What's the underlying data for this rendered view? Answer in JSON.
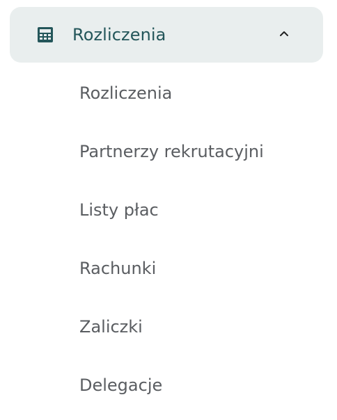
{
  "section": {
    "title": "Rozliczenia",
    "icon": "calculator-icon",
    "toggle_icon": "chevron-up-icon",
    "expanded": true,
    "colors": {
      "header_bg": "#e9eeee",
      "header_text": "#24565a",
      "item_text": "#5a5d61"
    }
  },
  "submenu": {
    "items": [
      {
        "label": "Rozliczenia"
      },
      {
        "label": "Partnerzy rekrutacyjni"
      },
      {
        "label": "Listy płac"
      },
      {
        "label": "Rachunki"
      },
      {
        "label": "Zaliczki"
      },
      {
        "label": "Delegacje"
      }
    ]
  }
}
